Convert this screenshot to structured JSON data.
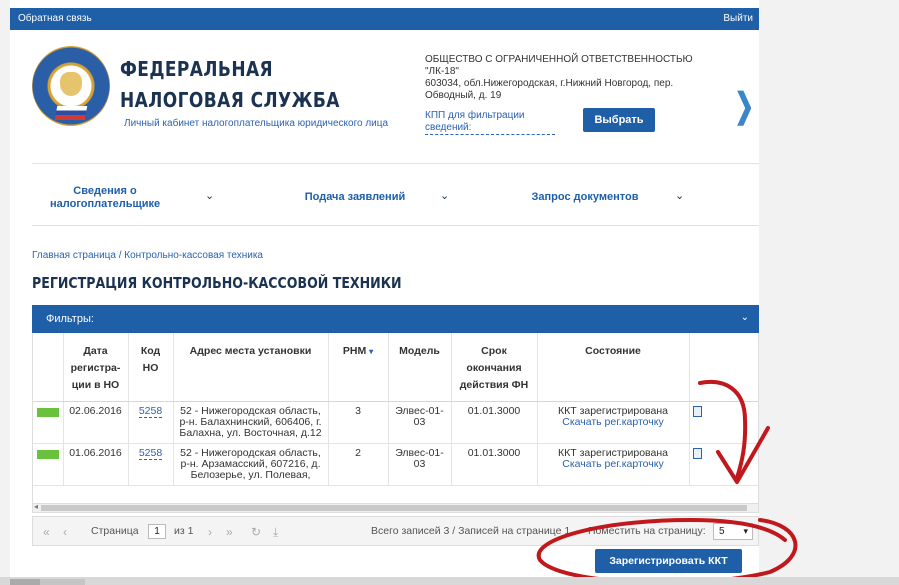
{
  "topbar": {
    "feedback": "Обратная связь",
    "logout": "Выйти"
  },
  "header": {
    "title_line1": "ФЕДЕРАЛЬНАЯ",
    "title_line2": "НАЛОГОВАЯ СЛУЖБА",
    "subtitle": "Личный кабинет налогоплательщика юридического лица",
    "org_name": "ОБЩЕСТВО С ОГРАНИЧЕННОЙ ОТВЕТСТВЕННОСТЬЮ \"ЛК-18\"",
    "org_address": "603034, обл.Нижегородская, г.Нижний Новгород, пер. Обводный, д. 19",
    "kpp_link": "КПП для фильтрации сведений:",
    "select_button": "Выбрать"
  },
  "nav": {
    "item1": "Сведения о налогоплательщике",
    "item2": "Подача заявлений",
    "item3": "Запрос документов"
  },
  "breadcrumb": "Главная страница / Контрольно-кассовая техника",
  "page_title": "РЕГИСТРАЦИЯ КОНТРОЛЬНО-КАССОВОЙ ТЕХНИКИ",
  "filters_label": "Фильтры:",
  "table": {
    "headers": [
      "Дата регистра-ции в НО",
      "Код НО",
      "Адрес места установки",
      "РНМ",
      "Модель",
      "Срок окончания действия ФН",
      "Состояние"
    ],
    "rows": [
      {
        "date": "02.06.2016",
        "code": "5258",
        "address": "52 - Нижегородская область, р-н. Балахнинский, 606406, г. Балахна, ул. Восточная, д.12",
        "rnm": "3",
        "model": "Элвес-01-03",
        "fn_expiry": "01.01.3000",
        "status": "ККТ зарегистрирована",
        "card_link": "Скачать рег.карточку"
      },
      {
        "date": "01.06.2016",
        "code": "5258",
        "address": "52 - Нижегородская область, р-н. Арзамасский, 607216, д. Белозерье, ул. Полевая,",
        "rnm": "2",
        "model": "Элвес-01-03",
        "fn_expiry": "01.01.3000",
        "status": "ККТ зарегистрирована",
        "card_link": "Скачать рег.карточку"
      }
    ]
  },
  "pager": {
    "page_label": "Страница",
    "page_value": "1",
    "of_label": "из 1",
    "summary": "Всего записей 3 / Записей на странице 1",
    "per_page_label": "Поместить на страницу:",
    "per_page_value": "5"
  },
  "register_button": "Зарегистрировать ККТ",
  "colors": {
    "primary": "#1e5fa8",
    "status_green": "#6ac13c",
    "annotation_red": "#c0181c"
  }
}
